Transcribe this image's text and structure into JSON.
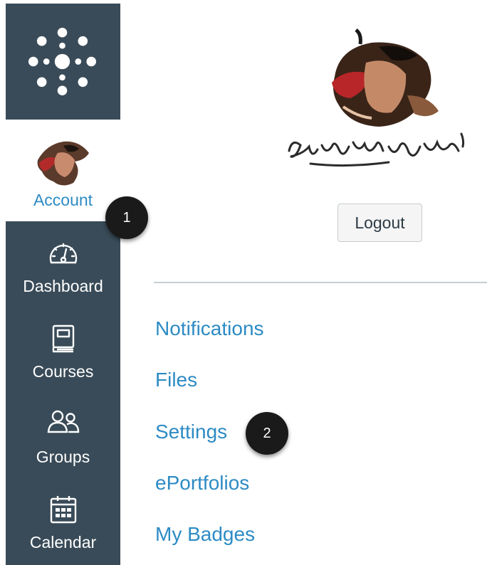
{
  "nav": {
    "logo_icon": "canvas-logo-icon",
    "account": {
      "label": "Account",
      "icon": "avatar-image"
    },
    "items": [
      {
        "label": "Dashboard",
        "icon": "dashboard-gauge-icon"
      },
      {
        "label": "Courses",
        "icon": "book-icon"
      },
      {
        "label": "Groups",
        "icon": "people-icon"
      },
      {
        "label": "Calendar",
        "icon": "calendar-icon"
      }
    ]
  },
  "tray": {
    "logout_label": "Logout",
    "links": [
      "Notifications",
      "Files",
      "Settings",
      "ePortfolios",
      "My Badges"
    ]
  },
  "callouts": [
    "1",
    "2"
  ],
  "colors": {
    "nav_background": "#394b58",
    "link_blue": "#2d8bc4",
    "badge_background": "#1a1a1a"
  }
}
